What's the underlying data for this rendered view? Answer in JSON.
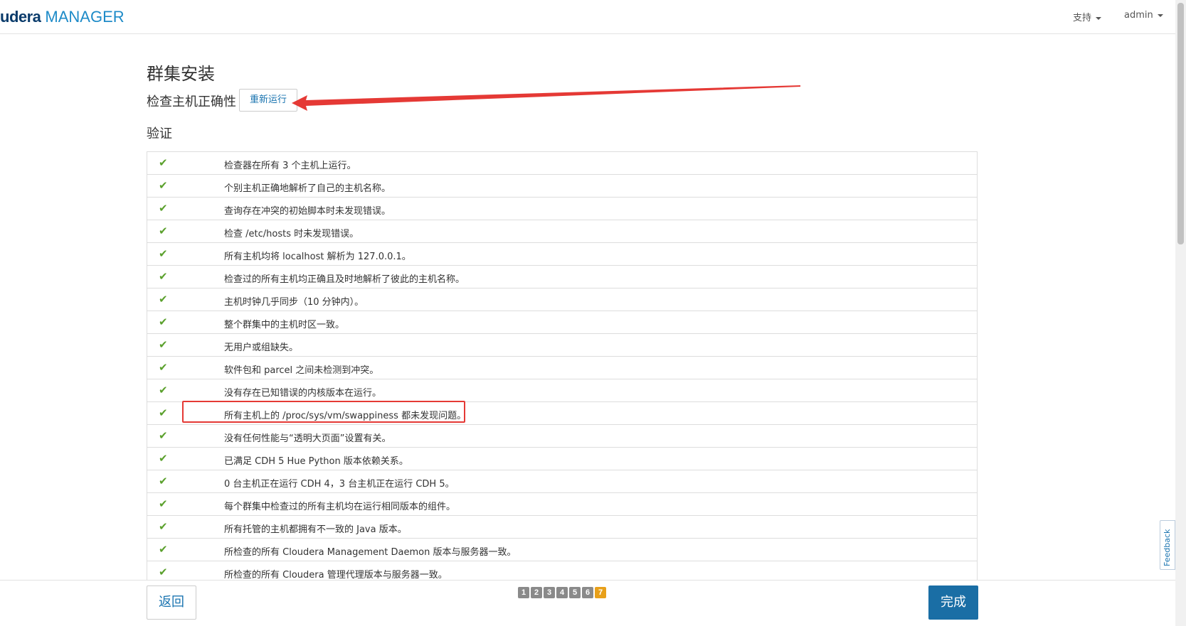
{
  "header": {
    "brand": "udera",
    "product": "MANAGER",
    "support_label": "支持",
    "user_label": "admin"
  },
  "page": {
    "title": "群集安装",
    "subtitle": "检查主机正确性",
    "rerun_label": "重新运行",
    "section_title": "验证"
  },
  "checks": [
    "检查器在所有 3 个主机上运行。",
    "个别主机正确地解析了自己的主机名称。",
    "查询存在冲突的初始脚本时未发现错误。",
    "检查 /etc/hosts 时未发现错误。",
    "所有主机均将 localhost 解析为 127.0.0.1。",
    "检查过的所有主机均正确且及时地解析了彼此的主机名称。",
    "主机时钟几乎同步（10 分钟内）。",
    "整个群集中的主机时区一致。",
    "无用户或组缺失。",
    "软件包和 parcel 之间未检测到冲突。",
    "没有存在已知错误的内核版本在运行。",
    "所有主机上的 /proc/sys/vm/swappiness 都未发现问题。",
    "没有任何性能与“透明大页面”设置有关。",
    "已满足 CDH 5 Hue Python 版本依赖关系。",
    "0 台主机正在运行 CDH 4，3 台主机正在运行 CDH 5。",
    "每个群集中检查过的所有主机均在运行相同版本的组件。",
    "所有托管的主机都拥有不一致的 Java 版本。",
    "所检查的所有 Cloudera Management Daemon 版本与服务器一致。",
    "所检查的所有 Cloudera 管理代理版本与服务器一致。"
  ],
  "footer": {
    "back_label": "返回",
    "finish_label": "完成",
    "steps": [
      "1",
      "2",
      "3",
      "4",
      "5",
      "6",
      "7"
    ],
    "active_step": "7"
  },
  "feedback_label": "Feedback",
  "colors": {
    "check": "#5aa02c",
    "primary": "#1a6ea5",
    "link": "#1a74b0",
    "annotation": "#e53935",
    "active_step": "#e8a01a"
  }
}
